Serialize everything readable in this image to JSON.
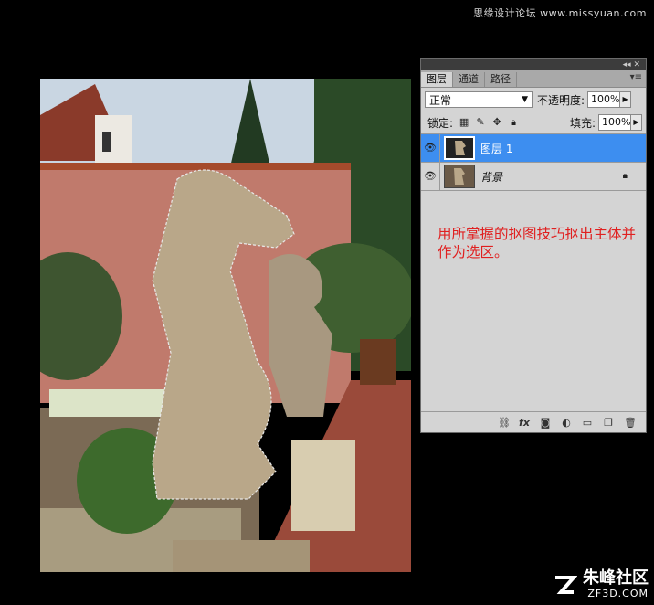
{
  "watermark": {
    "top": "思缘设计论坛 www.missyuan.com",
    "cn": "朱峰社区",
    "en": "ZF3D.COM"
  },
  "panel": {
    "tabs": [
      "图层",
      "通道",
      "路径"
    ],
    "active_tab": 0,
    "blend_mode": "正常",
    "opacity_label": "不透明度:",
    "opacity_value": "100%",
    "lock_label": "锁定:",
    "fill_label": "填充:",
    "fill_value": "100%",
    "layers": [
      {
        "name": "图层 1",
        "selected": true,
        "visible": true
      },
      {
        "name": "背景",
        "selected": false,
        "visible": true,
        "locked": true
      }
    ],
    "instruction": "用所掌握的抠图技巧抠出主体并作为选区。"
  },
  "icons": {
    "eye": "eye-icon",
    "lock_transparent": "lock-transparent-icon",
    "lock_paint": "brush-icon",
    "lock_move": "move-icon",
    "lock_all": "lock-icon",
    "link": "link-icon",
    "fx": "fx-icon",
    "mask": "mask-icon",
    "adjust": "adjustment-icon",
    "folder": "folder-icon",
    "new_layer": "new-layer-icon",
    "trash": "trash-icon"
  },
  "colors": {
    "selection": "#3d8ef0",
    "instruction": "#e02020"
  }
}
